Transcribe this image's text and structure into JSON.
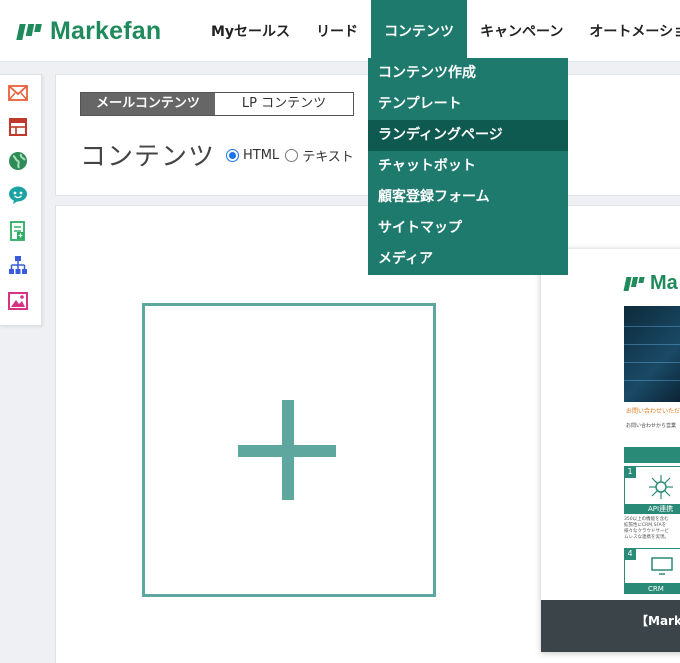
{
  "brand": {
    "name": "Markefan",
    "color": "#1f8a5b"
  },
  "nav": {
    "items": [
      {
        "label": "Myセールス"
      },
      {
        "label": "リード"
      },
      {
        "label": "コンテンツ",
        "active": true
      },
      {
        "label": "キャンペーン"
      },
      {
        "label": "オートメーション"
      }
    ]
  },
  "dropdown": {
    "items": [
      {
        "label": "コンテンツ作成"
      },
      {
        "label": "テンプレート"
      },
      {
        "label": "ランディングページ",
        "hover": true
      },
      {
        "label": "チャットボット"
      },
      {
        "label": "顧客登録フォーム"
      },
      {
        "label": "サイトマップ"
      },
      {
        "label": "メディア"
      }
    ]
  },
  "sidebar": {
    "icons": [
      "mail-icon",
      "layout-icon",
      "globe-icon",
      "chat-bot-icon",
      "form-icon",
      "sitemap-icon",
      "media-icon"
    ]
  },
  "content": {
    "tabs": [
      {
        "label": "メールコンテンツ",
        "active": true
      },
      {
        "label": "LP コンテンツ",
        "active": false
      }
    ],
    "title": "コンテンツ",
    "radio": [
      {
        "label": "HTML",
        "checked": true
      },
      {
        "label": "テキスト",
        "checked": false
      }
    ]
  },
  "preview": {
    "logo_text": "Ma",
    "orange_text": "お問い合わせいただ",
    "small_text": "お問い合わせから営業",
    "tiles": [
      {
        "num": "1",
        "label": "API連携",
        "desc": [
          "350以上の機能を含む",
          "拡張性にCRM,SFAを",
          "様々なクラウドサービ",
          "ムレスな連携を実現。"
        ]
      },
      {
        "num": "4",
        "label": "CRM"
      }
    ],
    "footer_text": "【Marke"
  },
  "colors": {
    "accent": "#1f7a6e",
    "accent_hover": "#0f5a50",
    "plus": "#5ea79e"
  }
}
